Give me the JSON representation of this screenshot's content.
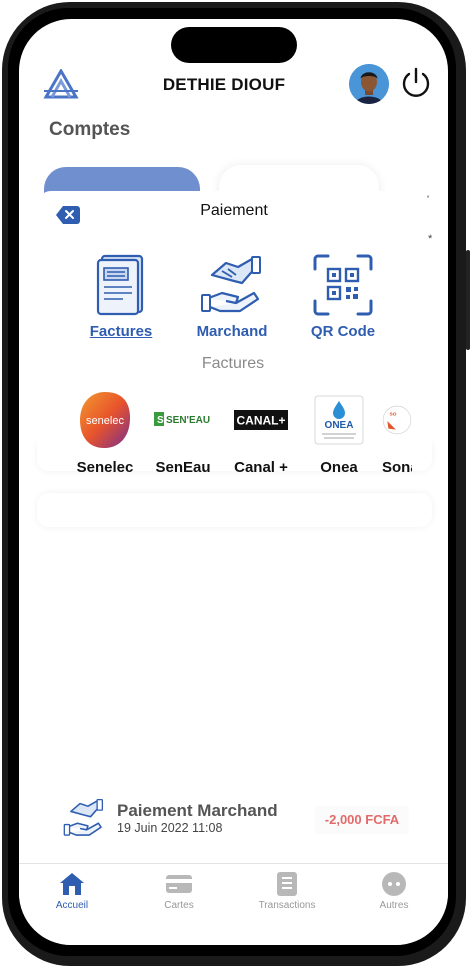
{
  "header": {
    "user_name": "DETHIE DIOUF",
    "logo_icon": "brand-logo-icon",
    "avatar_icon": "user-avatar",
    "power_icon": "power-icon"
  },
  "accounts": {
    "title": "Comptes"
  },
  "payment": {
    "title": "Paiement",
    "close_icon": "close-icon",
    "actions": [
      {
        "label": "Factures",
        "icon": "invoice-icon",
        "active": true
      },
      {
        "label": "Marchand",
        "icon": "handshake-icon",
        "active": false
      },
      {
        "label": "QR Code",
        "icon": "qr-code-icon",
        "active": false
      }
    ],
    "section_label": "Factures",
    "billers": [
      {
        "name": "Senelec",
        "logo_text": "senelec"
      },
      {
        "name": "SenEau",
        "logo_text": "SEN'EAU"
      },
      {
        "name": "Canal +",
        "logo_text": "CANAL+"
      },
      {
        "name": "Onea",
        "logo_text": "ONEA"
      },
      {
        "name": "Sonatel",
        "logo_text": "SO"
      }
    ]
  },
  "recent_transaction": {
    "title": "Paiement Marchand",
    "date": "19 Juin 2022  11:08",
    "amount": "-2,000 FCFA",
    "icon": "handshake-icon"
  },
  "tabbar": {
    "tabs": [
      {
        "label": "Accueil",
        "icon": "home-icon",
        "active": true
      },
      {
        "label": "Cartes",
        "icon": "card-icon",
        "active": false
      },
      {
        "label": "Transactions",
        "icon": "transactions-icon",
        "active": false
      },
      {
        "label": "Autres",
        "icon": "more-icon",
        "active": false
      }
    ]
  },
  "colors": {
    "accent": "#2f5db0",
    "card_blue": "#6f8fcf",
    "negative_amount": "#e46a6a",
    "senelec_orange": "#e8542c",
    "seneau_green": "#3a9a3e"
  }
}
